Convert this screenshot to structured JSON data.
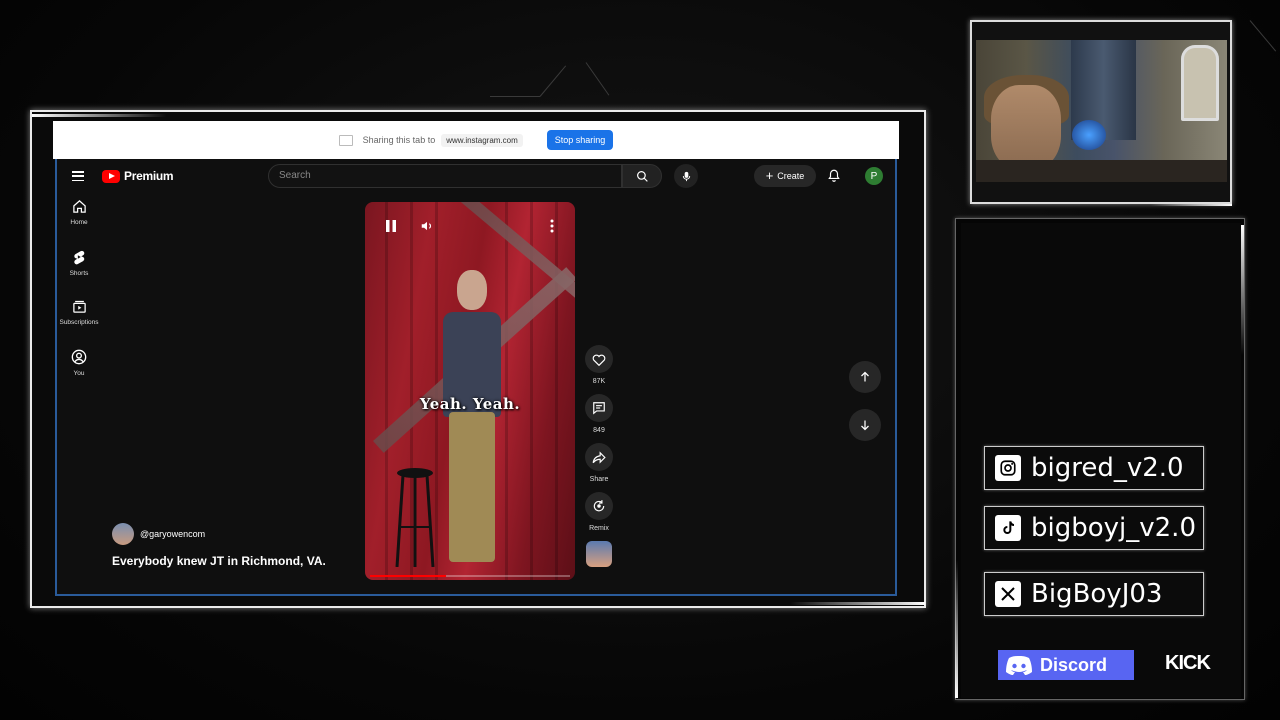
{
  "share_bar": {
    "text": "Sharing this tab to",
    "url": "www.instagram.com",
    "stop_label": "Stop sharing"
  },
  "youtube": {
    "logo_text": "Premium",
    "search_placeholder": "Search",
    "create_label": "Create",
    "avatar_letter": "P",
    "sidebar": [
      {
        "label": "Home",
        "icon": "home-icon"
      },
      {
        "label": "Shorts",
        "icon": "shorts-icon"
      },
      {
        "label": "Subscriptions",
        "icon": "subscriptions-icon"
      },
      {
        "label": "You",
        "icon": "user-icon"
      }
    ],
    "video": {
      "caption": "Yeah. Yeah.",
      "progress": 0.38
    },
    "actions": {
      "likes": "87K",
      "comments": "849",
      "share": "Share",
      "remix": "Remix"
    },
    "channel": "@garyowencom",
    "title": "Everybody knew JT in Richmond, VA."
  },
  "socials": {
    "instagram": "bigred_v2.0",
    "tiktok": "bigboyj_v2.0",
    "x": "BigBoyJ03",
    "discord": "Discord",
    "kick": "KICK"
  },
  "colors": {
    "stop_button": "#1a73e8",
    "yt_red": "#ff0000",
    "discord": "#5865f2",
    "frame_border": "#2a5b9a"
  }
}
